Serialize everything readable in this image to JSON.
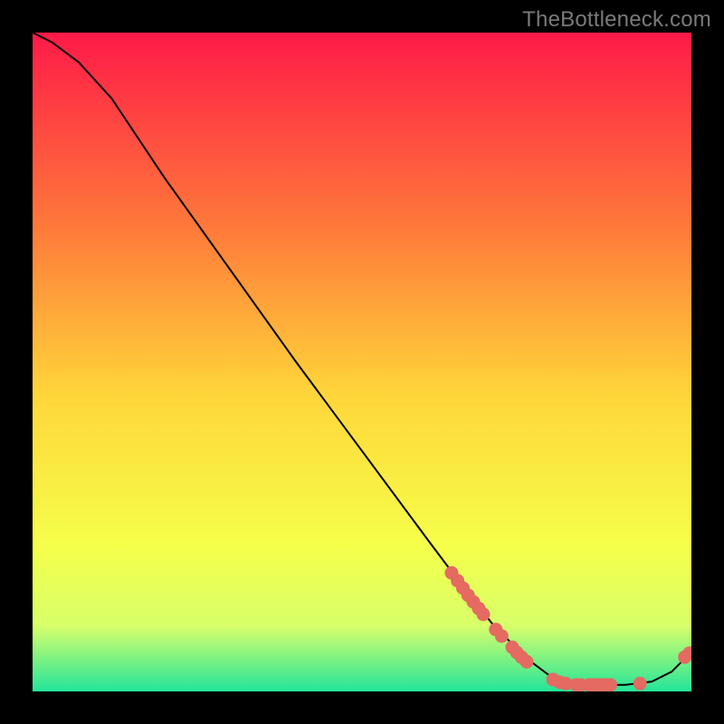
{
  "watermark": "TheBottleneck.com",
  "colors": {
    "black": "#000000",
    "gradient_top": "#ff1a48",
    "gradient_mid1": "#ff7b3a",
    "gradient_mid2": "#ffd63a",
    "gradient_mid3": "#f5ff4a",
    "gradient_low": "#d8ff6a",
    "gradient_bottom": "#23e59a",
    "line": "#000000",
    "dot_fill": "#e46a62",
    "dot_stroke": "#b74a44"
  },
  "chart_data": {
    "type": "line",
    "title": "",
    "xlabel": "",
    "ylabel": "",
    "xlim": [
      0,
      100
    ],
    "ylim": [
      0,
      100
    ],
    "curve": [
      {
        "x": 0,
        "y": 100
      },
      {
        "x": 3,
        "y": 98.5
      },
      {
        "x": 7,
        "y": 95.5
      },
      {
        "x": 12,
        "y": 90
      },
      {
        "x": 20,
        "y": 78
      },
      {
        "x": 30,
        "y": 64
      },
      {
        "x": 40,
        "y": 50
      },
      {
        "x": 50,
        "y": 36.5
      },
      {
        "x": 60,
        "y": 23
      },
      {
        "x": 66,
        "y": 15
      },
      {
        "x": 70,
        "y": 10
      },
      {
        "x": 75,
        "y": 5
      },
      {
        "x": 79,
        "y": 2
      },
      {
        "x": 82,
        "y": 1
      },
      {
        "x": 86,
        "y": 1
      },
      {
        "x": 90,
        "y": 1
      },
      {
        "x": 94,
        "y": 1.5
      },
      {
        "x": 97,
        "y": 3
      },
      {
        "x": 100,
        "y": 6
      }
    ],
    "dot_clusters": [
      {
        "x": 63.6,
        "y": 18.0
      },
      {
        "x": 64.5,
        "y": 16.8
      },
      {
        "x": 65.3,
        "y": 15.7
      },
      {
        "x": 66.1,
        "y": 14.6
      },
      {
        "x": 66.9,
        "y": 13.6
      },
      {
        "x": 67.7,
        "y": 12.6
      },
      {
        "x": 68.4,
        "y": 11.7
      },
      {
        "x": 70.3,
        "y": 9.4
      },
      {
        "x": 71.2,
        "y": 8.4
      },
      {
        "x": 72.8,
        "y": 6.7
      },
      {
        "x": 73.5,
        "y": 5.9
      },
      {
        "x": 74.2,
        "y": 5.2
      },
      {
        "x": 75.0,
        "y": 4.5
      },
      {
        "x": 79.0,
        "y": 1.8
      },
      {
        "x": 80.0,
        "y": 1.4
      },
      {
        "x": 80.9,
        "y": 1.2
      },
      {
        "x": 82.5,
        "y": 1.0
      },
      {
        "x": 83.2,
        "y": 1.0
      },
      {
        "x": 84.5,
        "y": 1.0
      },
      {
        "x": 85.3,
        "y": 1.0
      },
      {
        "x": 86.1,
        "y": 1.0
      },
      {
        "x": 86.9,
        "y": 1.0
      },
      {
        "x": 87.7,
        "y": 1.0
      },
      {
        "x": 92.2,
        "y": 1.2
      },
      {
        "x": 99.0,
        "y": 5.2
      },
      {
        "x": 99.7,
        "y": 5.8
      }
    ]
  }
}
